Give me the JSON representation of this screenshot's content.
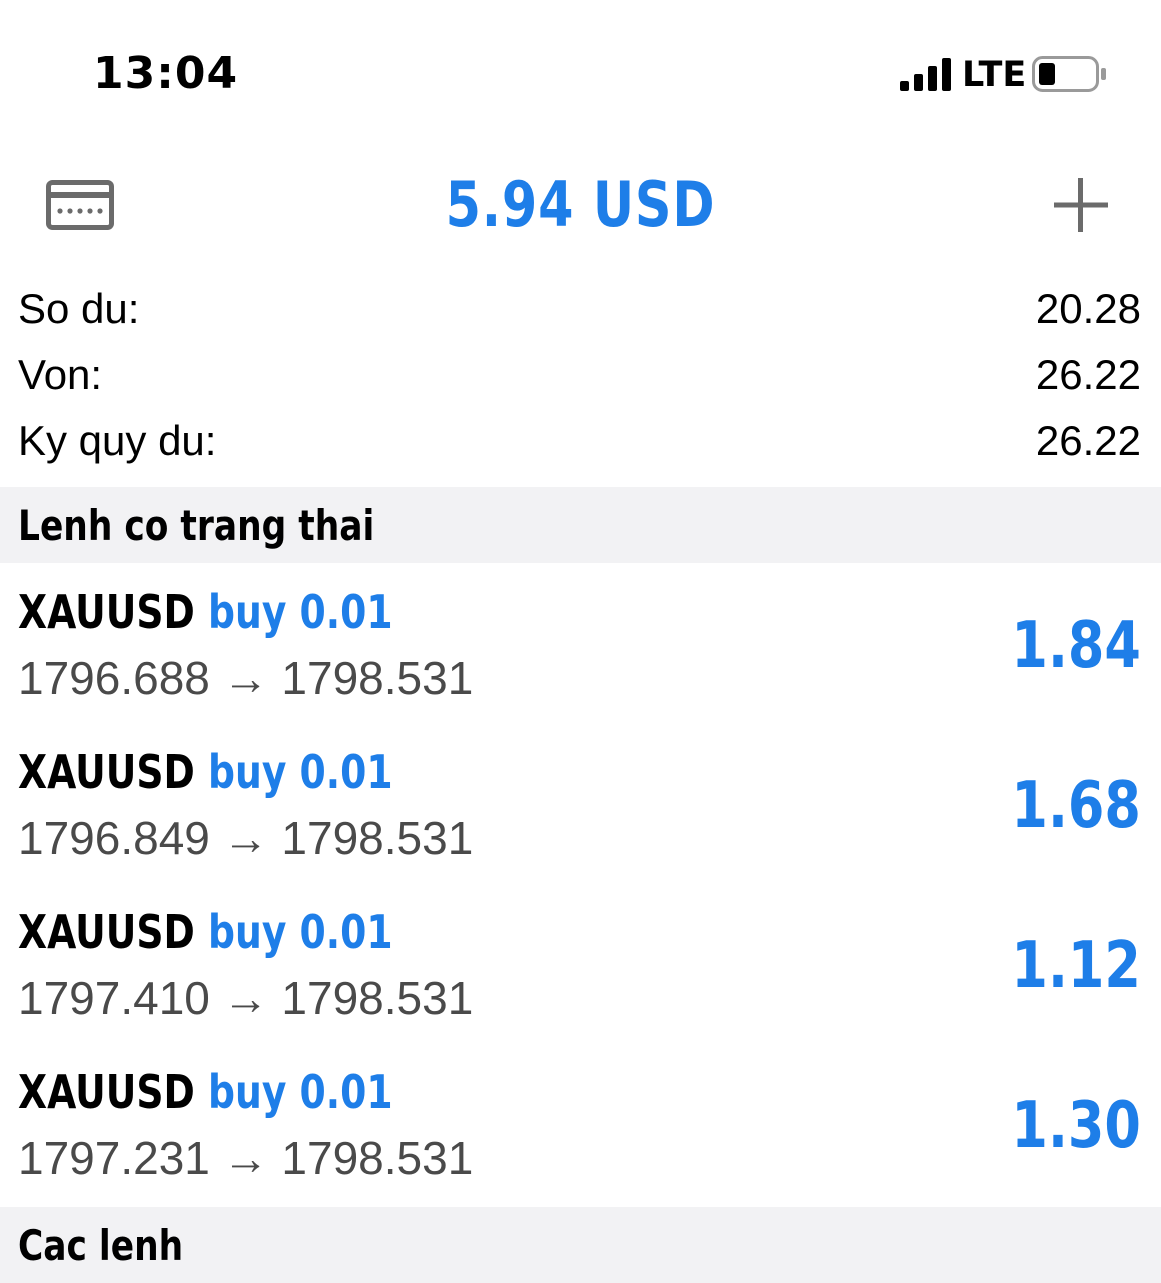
{
  "status_bar": {
    "time": "13:04",
    "network": "LTE"
  },
  "toolbar": {
    "title": "5.94 USD"
  },
  "summary": [
    {
      "label": "So du:",
      "value": "20.28"
    },
    {
      "label": "Von:",
      "value": "26.22"
    },
    {
      "label": "Ky quy du:",
      "value": "26.22"
    }
  ],
  "sections": {
    "open_positions": "Lenh co trang thai",
    "orders": "Cac lenh"
  },
  "positions": [
    {
      "symbol": "XAUUSD",
      "side": "buy 0.01",
      "prices": "1796.688 → 1798.531",
      "profit": "1.84"
    },
    {
      "symbol": "XAUUSD",
      "side": "buy 0.01",
      "prices": "1796.849 → 1798.531",
      "profit": "1.68"
    },
    {
      "symbol": "XAUUSD",
      "side": "buy 0.01",
      "prices": "1797.410 → 1798.531",
      "profit": "1.12"
    },
    {
      "symbol": "XAUUSD",
      "side": "buy 0.01",
      "prices": "1797.231 → 1798.531",
      "profit": "1.30"
    }
  ],
  "colors": {
    "accent": "#1e7ee8",
    "section_bg": "#f2f2f4"
  },
  "icons": {
    "left": "card-icon",
    "right": "plus-icon"
  }
}
